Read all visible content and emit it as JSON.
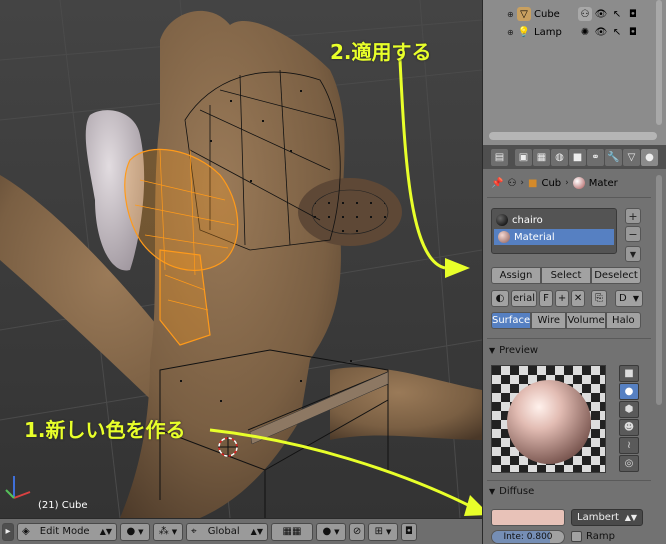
{
  "annotations": {
    "step_apply": "2.適用する",
    "step_create": "1.新しい色を作る"
  },
  "viewport": {
    "object_info": "(21) Cube"
  },
  "outliner": {
    "items": [
      {
        "label": "Cube",
        "icon": "mesh-triangle-icon"
      },
      {
        "label": "Lamp",
        "icon": "lamp-icon"
      }
    ]
  },
  "properties": {
    "breadcrumb": {
      "object": "Cub",
      "material": "Mater"
    },
    "material_slots": [
      {
        "label": "chairo",
        "color": "#1a1a1a"
      },
      {
        "label": "Material",
        "color": "#c08a86"
      }
    ],
    "slot_buttons": {
      "add": "+",
      "remove": "−",
      "down": "▼"
    },
    "assign_row": {
      "assign": "Assign",
      "select": "Select",
      "deselect": "Deselect"
    },
    "material_row": {
      "name": "erial",
      "fake_user": "F",
      "add": "+",
      "unlink": "✕",
      "data_label": "D"
    },
    "surface_types": [
      {
        "label": "Surface",
        "active": true
      },
      {
        "label": "Wire",
        "active": false
      },
      {
        "label": "Volume",
        "active": false
      },
      {
        "label": "Halo",
        "active": false
      }
    ],
    "preview_panel": {
      "title": "Preview"
    },
    "diffuse_panel": {
      "title": "Diffuse",
      "color": "#e8c2b8",
      "shader": "Lambert",
      "intensity_label": "Inte: 0.800",
      "intensity_value": 0.8,
      "ramp_label": "Ramp"
    }
  },
  "header3d": {
    "mode": "Edit Mode",
    "orientation": "Global"
  },
  "colors": {
    "accent_selected": "#5680c2",
    "annotation": "#e8ff2a",
    "model_brown": "#7a6045",
    "selection_orange": "#ff9a1a"
  }
}
